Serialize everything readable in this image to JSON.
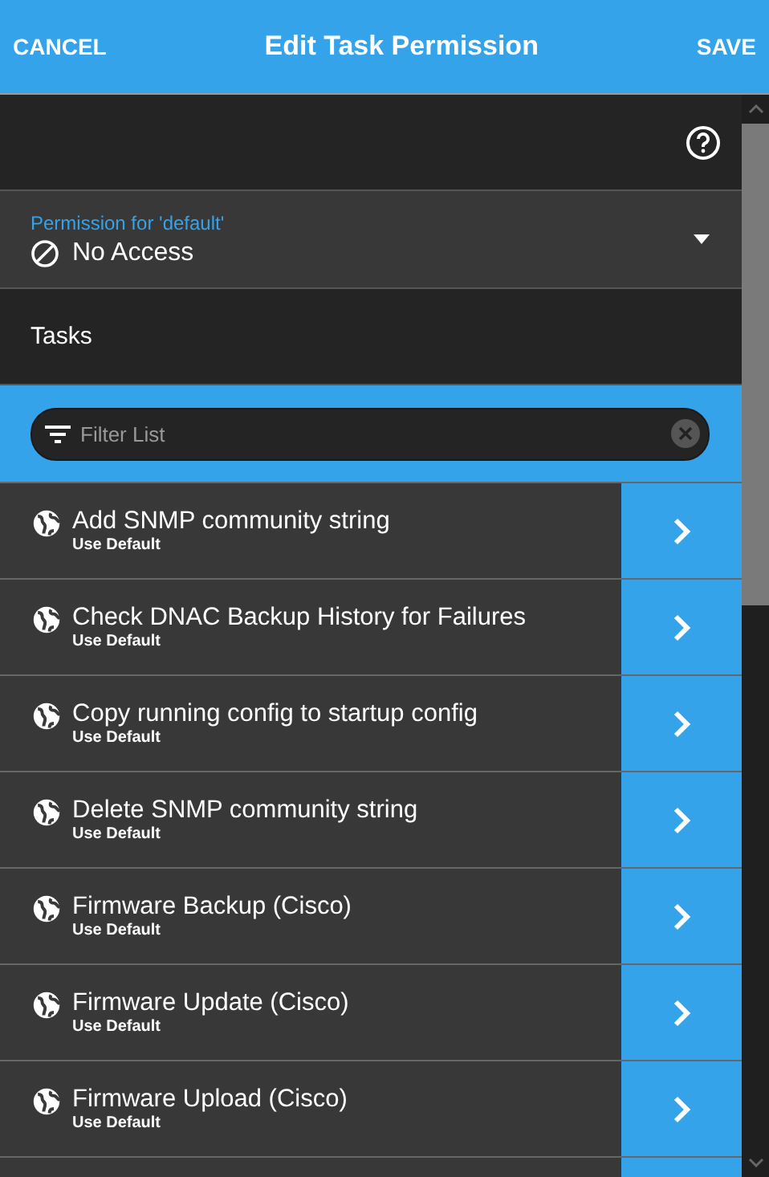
{
  "header": {
    "cancel": "CANCEL",
    "title": "Edit Task Permission",
    "save": "SAVE"
  },
  "permission": {
    "label": "Permission for 'default'",
    "value": "No Access"
  },
  "section_title": "Tasks",
  "filter": {
    "placeholder": "Filter List"
  },
  "tasks": [
    {
      "name": "Add SNMP community string",
      "setting": "Use Default"
    },
    {
      "name": "Check DNAC Backup History for Failures",
      "setting": "Use Default"
    },
    {
      "name": "Copy running config to startup config",
      "setting": "Use Default"
    },
    {
      "name": "Delete SNMP community string",
      "setting": "Use Default"
    },
    {
      "name": "Firmware Backup (Cisco)",
      "setting": "Use Default"
    },
    {
      "name": "Firmware Update (Cisco)",
      "setting": "Use Default"
    },
    {
      "name": "Firmware Upload (Cisco)",
      "setting": "Use Default"
    }
  ]
}
